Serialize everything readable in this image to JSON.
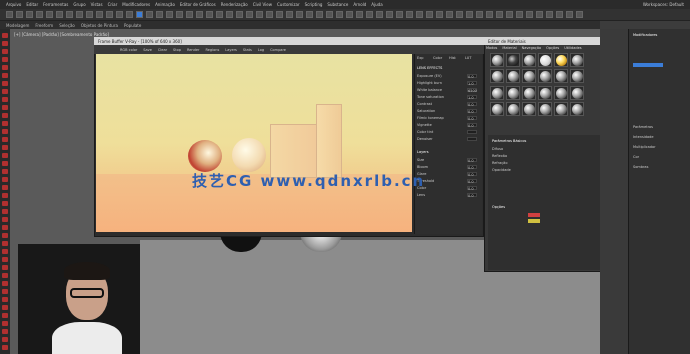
{
  "menu": [
    "Arquivo",
    "Editar",
    "Ferramentas",
    "Grupo",
    "Vistas",
    "Criar",
    "Modificadores",
    "Animação",
    "Editor de Gráficos",
    "Renderização",
    "Civil View",
    "Customizar",
    "Scripting",
    "Substance",
    "Arnold",
    "Ajuda"
  ],
  "workspace": "Workspaces: Default",
  "ribbon": [
    "Modelagem",
    "Freeform",
    "Seleção",
    "Objetos de Pintura",
    "Populate"
  ],
  "viewport_label": "[+] [Câmera] [Padrão] [Sombreamento Padrão]",
  "vfb": {
    "title": "Frame Buffer V-Ray - [100% of 640 x 360]",
    "tools": [
      "RGB color",
      "Save",
      "Clear",
      "Stop",
      "Render",
      "Regions",
      "Layers",
      "Stats",
      "Log",
      "Compare"
    ],
    "panel_tabs": [
      "Exp",
      "Color",
      "Hist",
      "LUT"
    ],
    "section": "LENS EFFECTS",
    "rows": [
      {
        "label": "Exposure (EV)",
        "value": "0.0"
      },
      {
        "label": "Highlight burn",
        "value": "1.0"
      },
      {
        "label": "White balance",
        "value": "6500"
      },
      {
        "label": "Tone saturation",
        "value": "1.0"
      },
      {
        "label": "Contrast",
        "value": "0.0"
      },
      {
        "label": "Saturation",
        "value": "0.0"
      },
      {
        "label": "Filmic tonemap",
        "value": "0.0"
      },
      {
        "label": "Vignette",
        "value": "0.0"
      },
      {
        "label": "Color tint",
        "value": ""
      },
      {
        "label": "Denoiser",
        "value": ""
      }
    ],
    "section2": "Layers",
    "rows2": [
      {
        "label": "Size",
        "value": "0.0"
      },
      {
        "label": "Bloom",
        "value": "0.0"
      },
      {
        "label": "Glare",
        "value": "0.0"
      },
      {
        "label": "Threshold",
        "value": "0.0"
      },
      {
        "label": "Color",
        "value": "0.0"
      },
      {
        "label": "Lens",
        "value": "0.0"
      }
    ]
  },
  "slate": {
    "title": "Editor de Materiais",
    "menu": [
      "Modos",
      "Material",
      "Navegação",
      "Opções",
      "Utilidades"
    ],
    "props_title": "Parâmetros Básicos",
    "rows": [
      "Difuso",
      "Reflexão",
      "Refração",
      "Opacidade"
    ],
    "section2": "Opções"
  },
  "right": {
    "title": "Modificadores",
    "rows": [
      "Parâmetros",
      "Intensidade",
      "Multiplicador",
      "Cor",
      "Sombras"
    ]
  },
  "watermark": "技艺CG  www.qdnxrlb.cn"
}
